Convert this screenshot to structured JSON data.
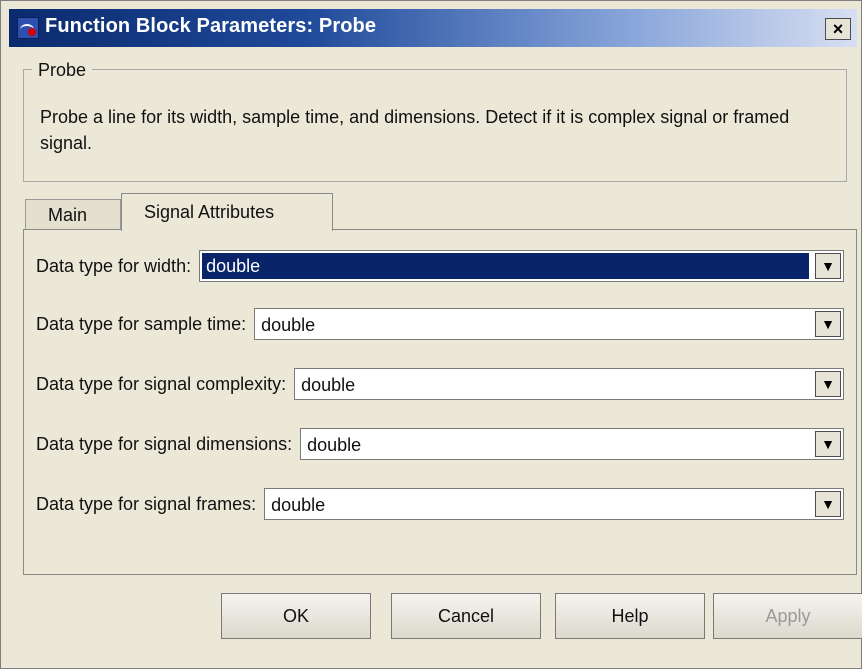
{
  "window": {
    "title": "Function Block Parameters: Probe",
    "close_symbol": "×",
    "icons": {
      "title_icon": "simulink-block-icon",
      "close_icon": "close-icon"
    }
  },
  "groupbox": {
    "title": "Probe",
    "description": "Probe a line for its width, sample time, and dimensions. Detect if it is complex signal or framed signal."
  },
  "tabs": [
    {
      "label": "Main",
      "active": false
    },
    {
      "label": "Signal Attributes",
      "active": true
    }
  ],
  "fields": [
    {
      "label": "Data type for width:",
      "value": "double",
      "selected": true
    },
    {
      "label": "Data type for sample time:",
      "value": "double",
      "selected": false
    },
    {
      "label": "Data type for signal complexity:",
      "value": "double",
      "selected": false
    },
    {
      "label": "Data type for signal dimensions:",
      "value": "double",
      "selected": false
    },
    {
      "label": "Data type for signal frames:",
      "value": "double",
      "selected": false
    }
  ],
  "buttons": {
    "ok": "OK",
    "cancel": "Cancel",
    "help": "Help",
    "apply": "Apply"
  },
  "colors": {
    "selection": "#0a246a",
    "title_start": "#0b2a6e",
    "title_end": "#d7dff2",
    "dialog_bg": "#ebe8d8"
  },
  "dropdown_arrow": "▼"
}
